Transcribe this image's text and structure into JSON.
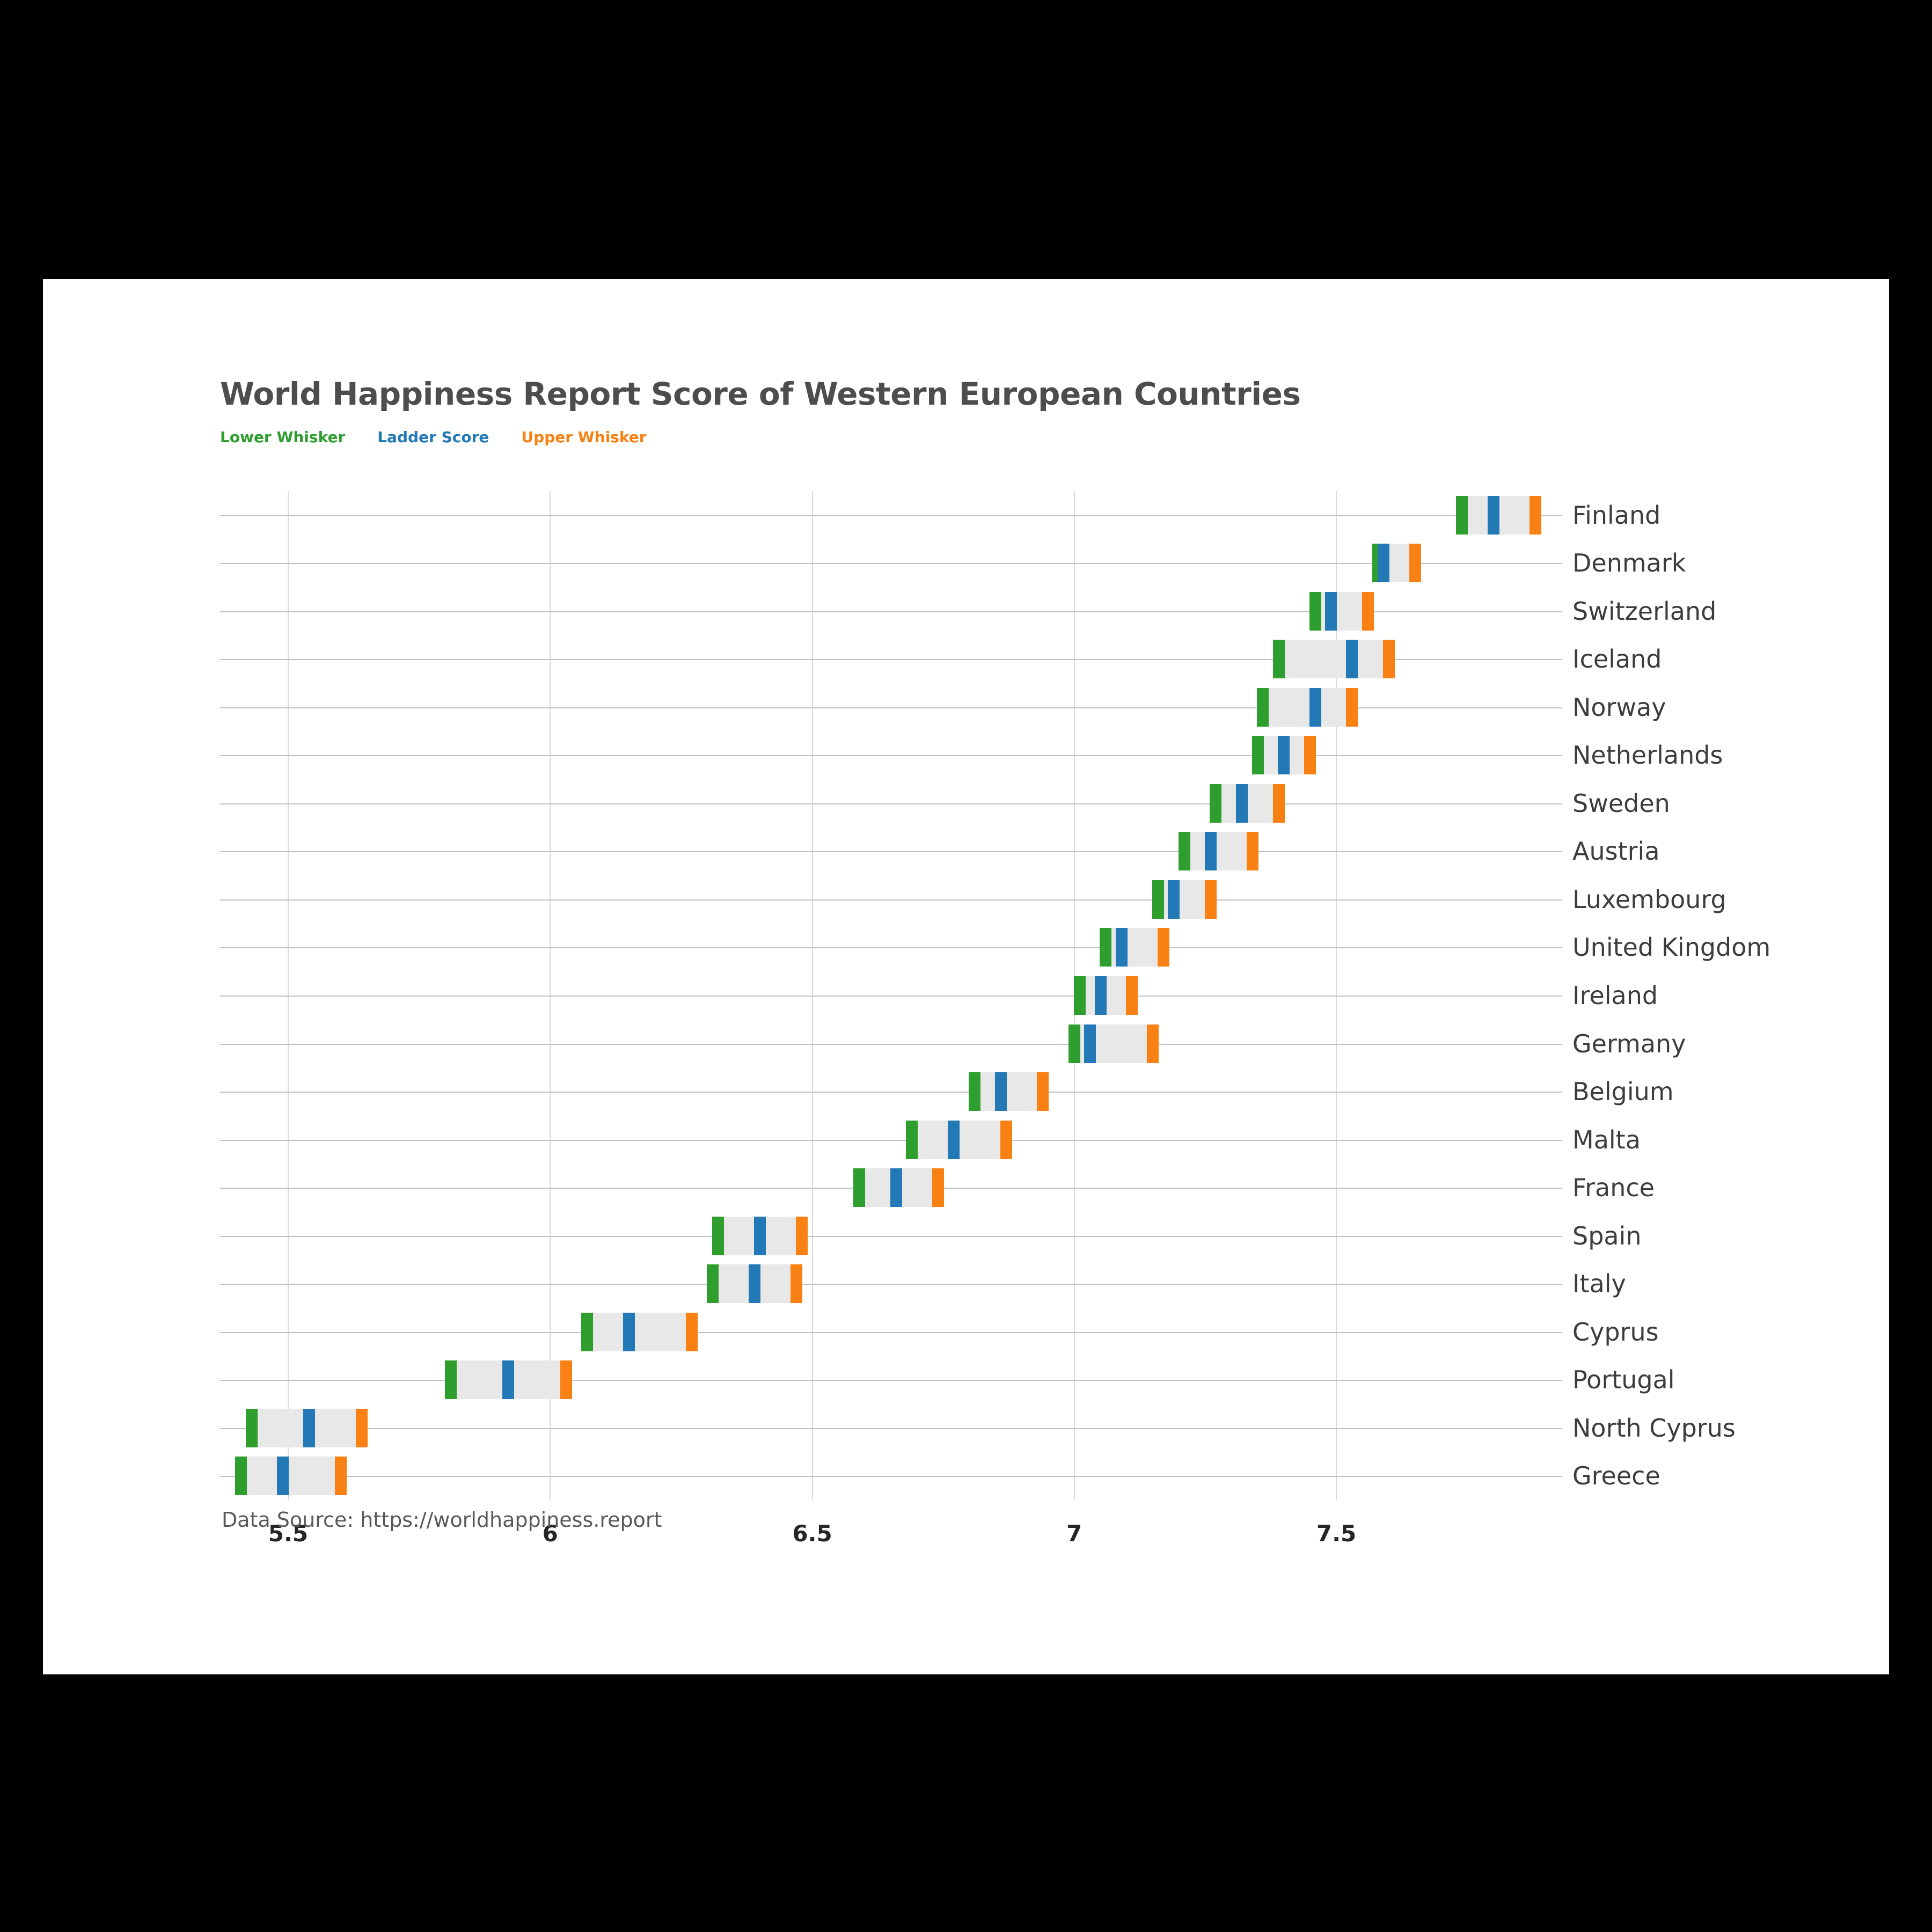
{
  "chart_data": {
    "type": "bar",
    "title": "World Happiness Report Score of Western European Countries",
    "subtitle": "",
    "xlabel": "",
    "ylabel": "",
    "source_note": "Data Source: https://worldhappiness.report",
    "grid": true,
    "legend_position": "top-left",
    "xlim": [
      5.37,
      7.93
    ],
    "xticks": [
      "5.5",
      "6",
      "6.5",
      "7",
      "7.5"
    ],
    "xtick_values": [
      5.5,
      6.0,
      6.5,
      7.0,
      7.5
    ],
    "legend": [
      {
        "name": "Lower Whisker",
        "color": "#2e9e2e"
      },
      {
        "name": "Ladder Score",
        "color": "#2279b5"
      },
      {
        "name": "Upper Whisker",
        "color": "#f98012"
      }
    ],
    "series": [
      {
        "name": "Lower Whisker",
        "color": "#2e9e2e"
      },
      {
        "name": "Ladder Score",
        "color": "#2279b5"
      },
      {
        "name": "Upper Whisker",
        "color": "#f98012"
      }
    ],
    "categories": [
      "Finland",
      "Denmark",
      "Switzerland",
      "Iceland",
      "Norway",
      "Netherlands",
      "Sweden",
      "Austria",
      "Luxembourg",
      "United Kingdom",
      "Ireland",
      "Germany",
      "Belgium",
      "Malta",
      "France",
      "Spain",
      "Italy",
      "Cyprus",
      "Portugal",
      "North Cyprus",
      "Greece"
    ],
    "rows": [
      {
        "country": "Finland",
        "lower": 7.74,
        "score": 7.8,
        "upper": 7.88
      },
      {
        "country": "Denmark",
        "lower": 7.58,
        "score": 7.59,
        "upper": 7.65
      },
      {
        "country": "Switzerland",
        "lower": 7.46,
        "score": 7.49,
        "upper": 7.56
      },
      {
        "country": "Iceland",
        "lower": 7.39,
        "score": 7.53,
        "upper": 7.6
      },
      {
        "country": "Norway",
        "lower": 7.36,
        "score": 7.46,
        "upper": 7.53
      },
      {
        "country": "Netherlands",
        "lower": 7.35,
        "score": 7.4,
        "upper": 7.45
      },
      {
        "country": "Sweden",
        "lower": 7.27,
        "score": 7.32,
        "upper": 7.39
      },
      {
        "country": "Austria",
        "lower": 7.21,
        "score": 7.26,
        "upper": 7.34
      },
      {
        "country": "Luxembourg",
        "lower": 7.16,
        "score": 7.19,
        "upper": 7.26
      },
      {
        "country": "United Kingdom",
        "lower": 7.06,
        "score": 7.09,
        "upper": 7.17
      },
      {
        "country": "Ireland",
        "lower": 7.01,
        "score": 7.05,
        "upper": 7.11
      },
      {
        "country": "Germany",
        "lower": 7.0,
        "score": 7.03,
        "upper": 7.15
      },
      {
        "country": "Belgium",
        "lower": 6.81,
        "score": 6.86,
        "upper": 6.94
      },
      {
        "country": "Malta",
        "lower": 6.69,
        "score": 6.77,
        "upper": 6.87
      },
      {
        "country": "France",
        "lower": 6.59,
        "score": 6.66,
        "upper": 6.74
      },
      {
        "country": "Spain",
        "lower": 6.32,
        "score": 6.4,
        "upper": 6.48
      },
      {
        "country": "Italy",
        "lower": 6.31,
        "score": 6.39,
        "upper": 6.47
      },
      {
        "country": "Cyprus",
        "lower": 6.07,
        "score": 6.15,
        "upper": 6.27
      },
      {
        "country": "Portugal",
        "lower": 5.81,
        "score": 5.92,
        "upper": 6.03
      },
      {
        "country": "North Cyprus",
        "lower": 5.43,
        "score": 5.54,
        "upper": 5.64
      },
      {
        "country": "Greece",
        "lower": 5.41,
        "score": 5.49,
        "upper": 5.6
      }
    ]
  }
}
